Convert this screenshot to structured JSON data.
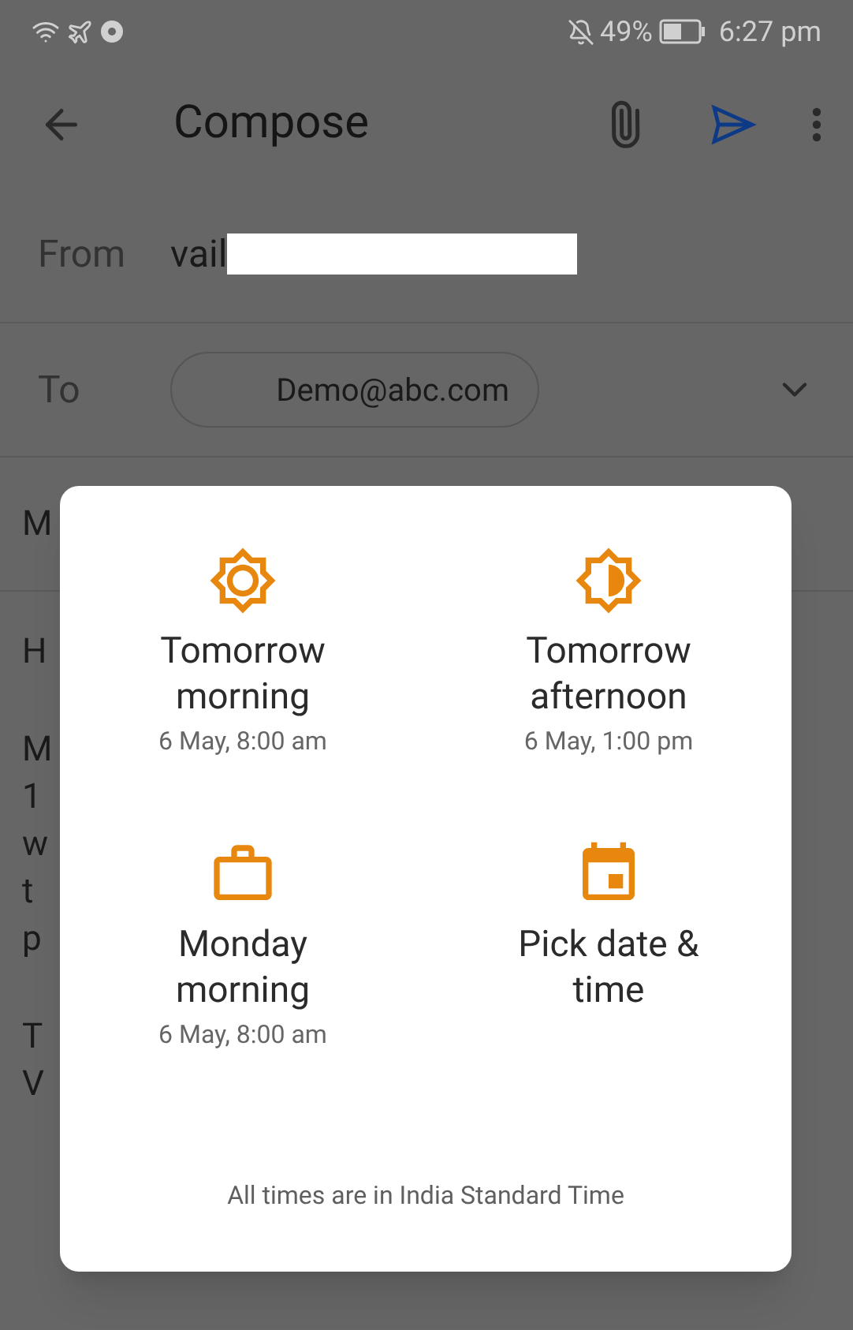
{
  "status_bar": {
    "battery": "49%",
    "time": "6:27 pm"
  },
  "toolbar": {
    "title": "Compose"
  },
  "from": {
    "label": "From",
    "value": "vail"
  },
  "to": {
    "label": "To",
    "chips": [
      "Demo@abc.com"
    ]
  },
  "subject": {
    "visible_text": "M"
  },
  "body": {
    "visible_lines": [
      "H",
      "M",
      "1",
      "w",
      "t",
      "p",
      "T",
      "V"
    ]
  },
  "schedule_dialog": {
    "options": [
      {
        "kind": "sun",
        "title": "Tomorrow morning",
        "subtitle": "6 May, 8:00 am"
      },
      {
        "kind": "half-sun",
        "title": "Tomorrow afternoon",
        "subtitle": "6 May, 1:00 pm"
      },
      {
        "kind": "briefcase",
        "title": "Monday morning",
        "subtitle": "6 May, 8:00 am"
      },
      {
        "kind": "calendar",
        "title": "Pick date & time"
      }
    ],
    "footer": "All times are in India Standard Time"
  }
}
